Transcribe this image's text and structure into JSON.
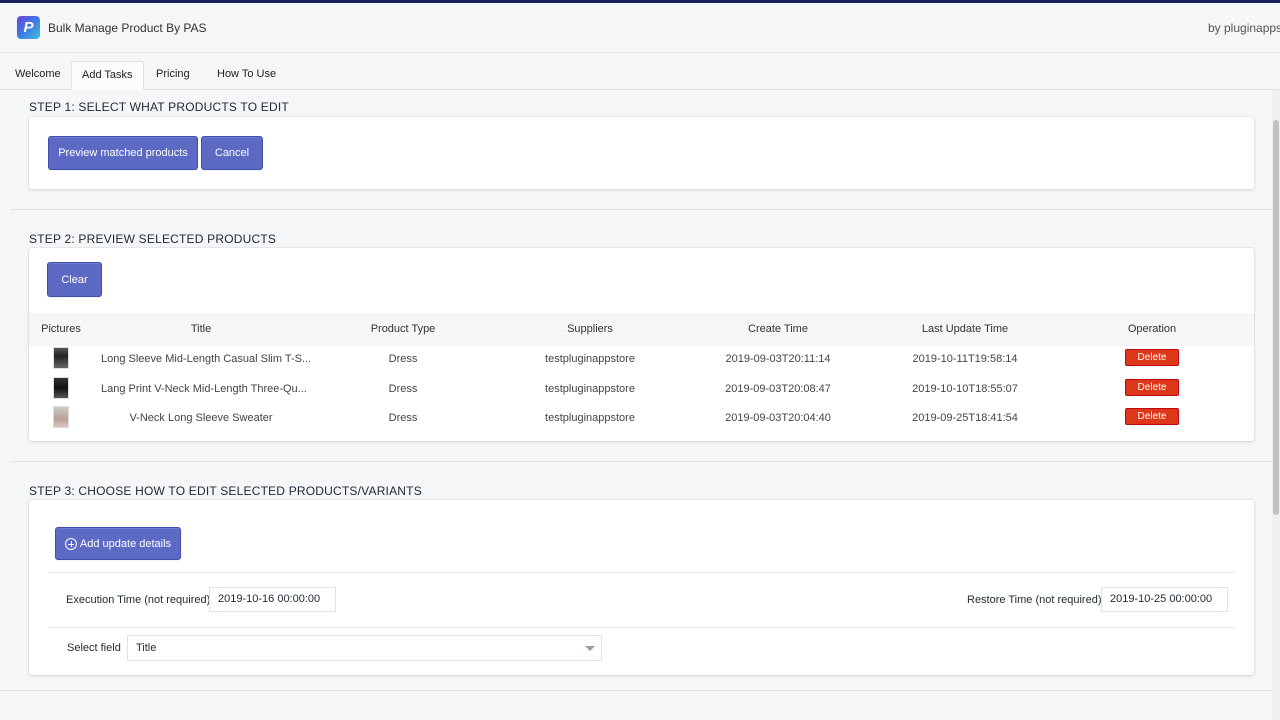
{
  "app": {
    "title": "Bulk Manage Product By PAS",
    "by_text": "by pluginappstore",
    "logo_letter": "P"
  },
  "tabs": [
    {
      "label": "Welcome"
    },
    {
      "label": "Add Tasks",
      "active": true
    },
    {
      "label": "Pricing"
    },
    {
      "label": "How To Use"
    }
  ],
  "step1": {
    "title": "STEP 1: SELECT WHAT PRODUCTS TO EDIT",
    "preview_label": "Preview matched products",
    "cancel_label": "Cancel"
  },
  "step2": {
    "title": "STEP 2: PREVIEW SELECTED PRODUCTS",
    "clear_label": "Clear",
    "columns": [
      "Pictures",
      "Title",
      "Product Type",
      "Suppliers",
      "Create Time",
      "Last Update Time",
      "Operation"
    ],
    "rows": [
      {
        "title": "Long Sleeve Mid-Length Casual Slim T-S...",
        "type": "Dress",
        "supplier": "testpluginappstore",
        "created": "2019-09-03T20:11:14",
        "updated": "2019-10-11T19:58:14",
        "action": "Delete"
      },
      {
        "title": "Lang Print V-Neck Mid-Length Three-Qu...",
        "type": "Dress",
        "supplier": "testpluginappstore",
        "created": "2019-09-03T20:08:47",
        "updated": "2019-10-10T18:55:07",
        "action": "Delete"
      },
      {
        "title": "V-Neck Long Sleeve Sweater",
        "type": "Dress",
        "supplier": "testpluginappstore",
        "created": "2019-09-03T20:04:40",
        "updated": "2019-09-25T18:41:54",
        "action": "Delete"
      }
    ]
  },
  "step3": {
    "title": "STEP 3: CHOOSE HOW TO EDIT SELECTED PRODUCTS/VARIANTS",
    "add_label": "Add update details",
    "execution_label": "Execution Time (not required)",
    "execution_value": "2019-10-16 00:00:00",
    "restore_label": "Restore Time (not required)",
    "restore_value": "2019-10-25 00:00:00",
    "select_label": "Select field",
    "select_value": "Title"
  },
  "colors": {
    "primary": "#5c6ac4",
    "danger": "#de3618",
    "topbar": "#1c2260"
  }
}
